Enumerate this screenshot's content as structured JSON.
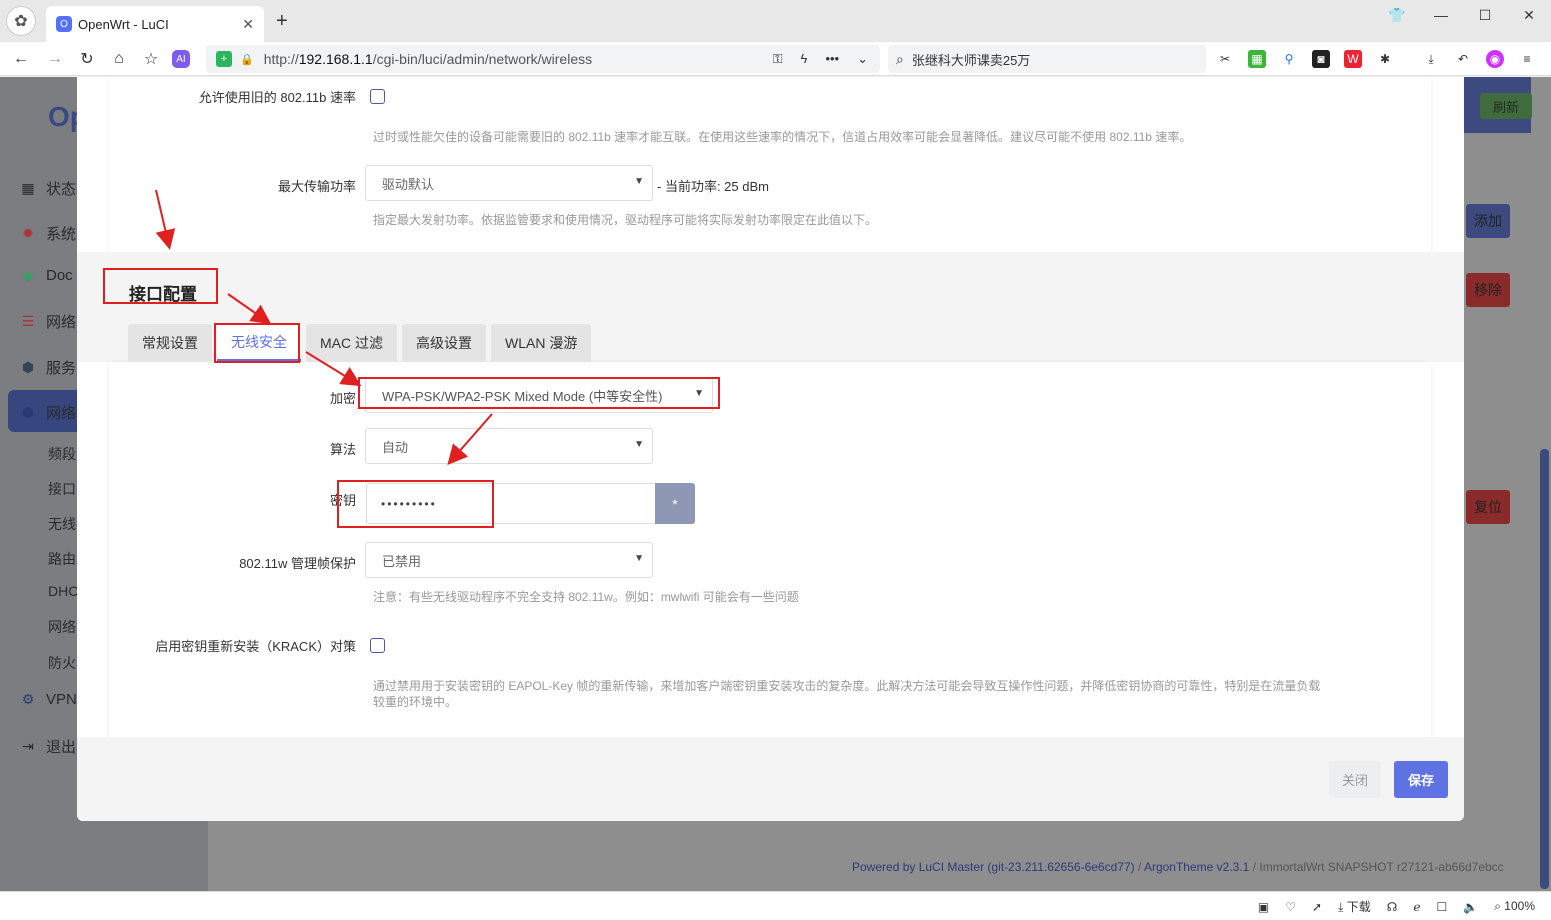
{
  "browser": {
    "tab_title": "OpenWrt - LuCI",
    "url_prefix": "http://",
    "url_host": "192.168.1.1",
    "url_path": "/cgi-bin/luci/admin/network/wireless",
    "search_text": "张继科大师课卖25万",
    "zoom": "100%",
    "download_label": "下载"
  },
  "background": {
    "brand": "Op",
    "refresh": "刷新",
    "add": "添加",
    "remove": "移除",
    "reset": "复位",
    "sidebar": [
      "状态",
      "系统",
      "Doc",
      "网络",
      "服务",
      "网络",
      "VPN",
      "退出"
    ],
    "subitems": [
      "频段",
      "接口",
      "无线",
      "路由",
      "DHC",
      "网络",
      "防火"
    ],
    "footer_link": "Powered by LuCI Master (git-23.211.62656-6e6cd77)",
    "footer_sep": " / ",
    "footer_theme": "ArgonTheme v2.3.1",
    "footer_rest": " / ImmortalWrt SNAPSHOT r27121-ab66d7ebcc"
  },
  "modal": {
    "legacy_rates_label": "允许使用旧的 802.11b 速率",
    "legacy_rates_desc": "过时或性能欠佳的设备可能需要旧的 802.11b 速率才能互联。在使用这些速率的情况下，信道占用效率可能会显著降低。建议尽可能不使用 802.11b 速率。",
    "txpower_label": "最大传输功率",
    "txpower_value": "驱动默认",
    "txpower_current": "- 当前功率: 25 dBm",
    "txpower_desc": "指定最大发射功率。依据监管要求和使用情况，驱动程序可能将实际发射功率限定在此值以下。",
    "section_title": "接口配置",
    "tabs": [
      "常规设置",
      "无线安全",
      "MAC 过滤",
      "高级设置",
      "WLAN 漫游"
    ],
    "encryption_label": "加密",
    "encryption_value": "WPA-PSK/WPA2-PSK Mixed Mode (中等安全性)",
    "cipher_label": "算法",
    "cipher_value": "自动",
    "key_label": "密钥",
    "key_value": "•••••••••",
    "key_reveal": "*",
    "mfp_label": "802.11w 管理帧保护",
    "mfp_value": "已禁用",
    "mfp_note": "注意：有些无线驱动程序不完全支持 802.11w。例如：mwlwifi 可能会有一些问题",
    "krack_label": "启用密钥重新安装（KRACK）对策",
    "krack_desc_1": "通过禁用用于安装密钥的 EAPOL-Key 帧的重新传输，来增加客户端密钥重安装攻击的复杂度。此解决方法可能会导致互操作性问题，并降低密钥协商的可靠性，特别是在流量负载",
    "krack_desc_2": "较重的环境中。",
    "close": "关闭",
    "save": "保存"
  },
  "colors": {
    "accent": "#5e72e4",
    "annotation": "#e02020"
  }
}
